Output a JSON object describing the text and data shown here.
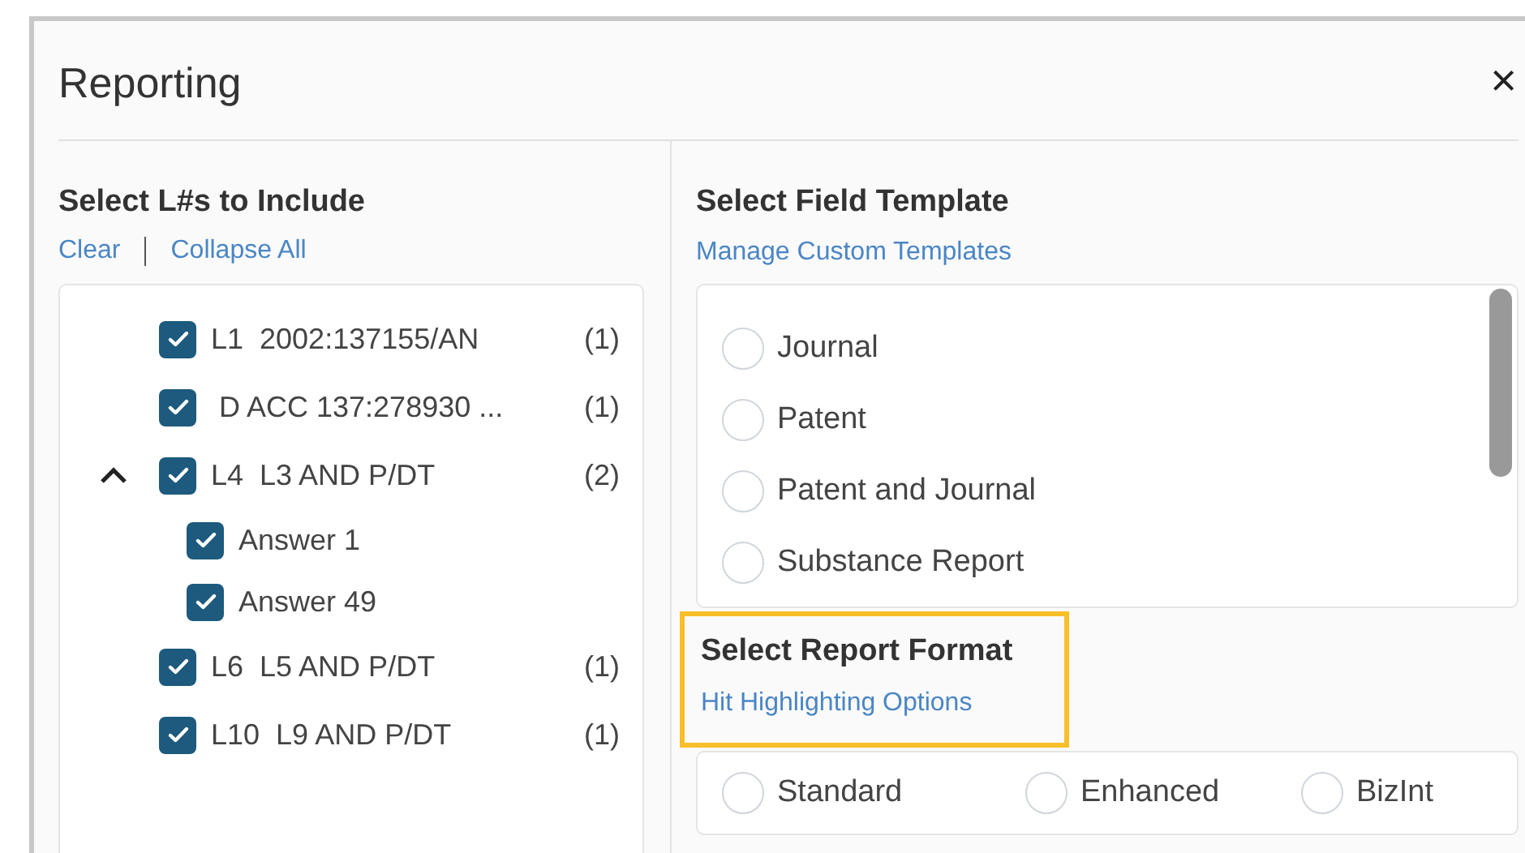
{
  "dialog": {
    "title": "Reporting",
    "close": "×"
  },
  "include": {
    "heading": "Select L#s to Include",
    "links": [
      "Clear",
      "Collapse All"
    ],
    "items": [
      {
        "label": "L1  2002:137155/AN",
        "count": "(1)",
        "checked": true
      },
      {
        "label": " D ACC 137:278930 ...",
        "count": "(1)",
        "checked": true
      },
      {
        "label": "L4  L3 AND P/DT",
        "count": "(2)",
        "checked": true,
        "expanded": true,
        "children": [
          {
            "label": "Answer 1",
            "checked": true
          },
          {
            "label": "Answer 49",
            "checked": true
          }
        ]
      },
      {
        "label": "L6  L5 AND P/DT",
        "count": "(1)",
        "checked": true
      },
      {
        "label": "L10  L9 AND P/DT",
        "count": "(1)",
        "checked": true
      }
    ]
  },
  "field_template": {
    "heading": "Select Field Template",
    "link": "Manage Custom Templates",
    "options": [
      {
        "label": "Journal",
        "selected": false
      },
      {
        "label": "Patent",
        "selected": false
      },
      {
        "label": "Patent and Journal",
        "selected": false
      },
      {
        "label": "Substance Report",
        "selected": false
      }
    ]
  },
  "report_format": {
    "heading": "Select Report Format",
    "link": "Hit Highlighting Options",
    "highlighted": true,
    "options": [
      {
        "label": "Standard",
        "selected": false
      },
      {
        "label": "Enhanced",
        "selected": false
      },
      {
        "label": "BizInt",
        "selected": false
      }
    ]
  }
}
